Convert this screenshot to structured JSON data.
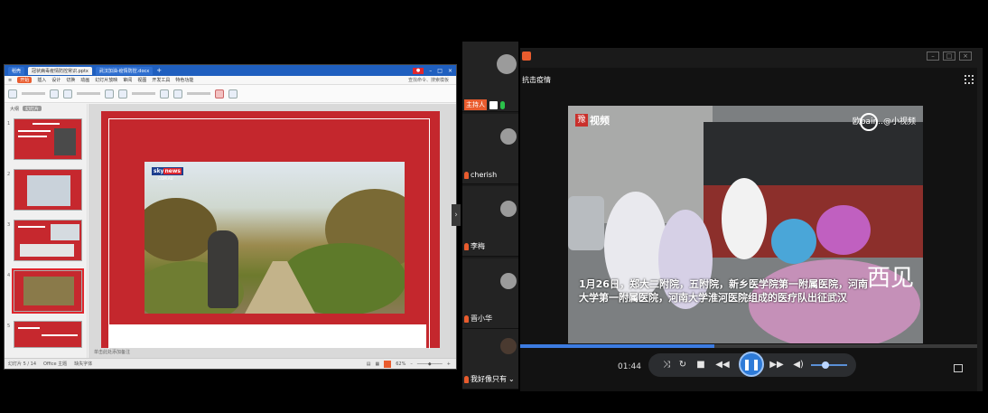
{
  "presentation": {
    "tabs": [
      "稻壳",
      "冠状病毒疫情防控常识.pptx",
      "武汉加油-疫情防控.docx"
    ],
    "menu": [
      "开始",
      "插入",
      "设计",
      "切换",
      "动画",
      "幻灯片放映",
      "审阅",
      "视图",
      "开发工具",
      "特色功能"
    ],
    "menu_highlight": "开始",
    "search": "查找命令、搜索模板",
    "panel_tabs": [
      "大纲",
      "幻灯片"
    ],
    "notes_placeholder": "单击此处添加备注",
    "status": [
      "幻灯片 5 / 14",
      "Office 主题",
      "缺失字体"
    ],
    "zoom": "62%",
    "slide_logo": "sky",
    "slide_logo_accent": "news",
    "slide_logo_sub": ".COM.AU",
    "colors": {
      "slide_red": "#c4272d",
      "accent": "#e95c2e"
    }
  },
  "participants": {
    "host_label": "主持人",
    "list": [
      {
        "name": "cherish"
      },
      {
        "name": "李梅"
      },
      {
        "name": "晋小华"
      },
      {
        "name": "我好像只有"
      }
    ]
  },
  "player": {
    "title": "抗击疫情",
    "logo_char": "豫",
    "logo_text": "视频",
    "watermark": "欧pain..@小视频",
    "subtitle": "1月26日，郑大二附院，五附院，新乡医学院第一附属医院，河南大学第一附属医院，河南大学淮河医院组成的医疗队出征武汉",
    "signature": "西见",
    "current_time": "01:44",
    "progress": 0.42,
    "volume": 0.4,
    "colors": {
      "progress": "#3c7be0",
      "play": "#2e7bd8"
    }
  }
}
